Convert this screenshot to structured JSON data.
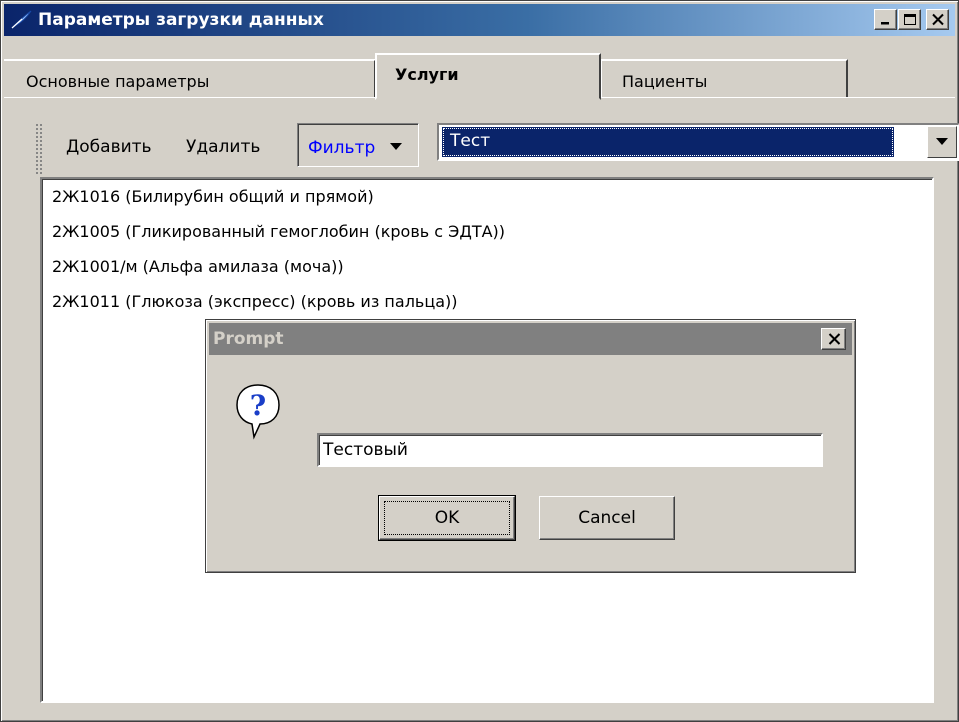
{
  "window": {
    "title": "Параметры загрузки данных",
    "icon": "app-feather-icon",
    "controls": [
      "minimize-icon",
      "maximize-icon",
      "close-icon"
    ]
  },
  "tabs": [
    {
      "label": "Основные параметры",
      "active": false
    },
    {
      "label": "Услуги",
      "active": true
    },
    {
      "label": "Пациенты",
      "active": false
    }
  ],
  "toolbar": {
    "add_label": "Добавить",
    "delete_label": "Удалить",
    "filter_label": "Фильтр",
    "combo_value": "Тест"
  },
  "services_list": [
    "2Ж1016 (Билирубин общий и прямой)",
    "2Ж1005 (Гликированный гемоглобин (кровь с ЭДТА))",
    "2Ж1001/м (Альфа амилаза (моча))",
    "2Ж1011 (Глюкоза (экспресс) (кровь из пальца))"
  ],
  "prompt_dialog": {
    "title": "Prompt",
    "icon": "question-icon",
    "input_value": "Тестовый",
    "ok_label": "OK",
    "cancel_label": "Cancel"
  },
  "colors": {
    "titlebar_active": "#0a246a",
    "titlebar_inactive": "#808080",
    "face": "#d4d0c8",
    "filter_text": "#0000ff",
    "selection": "#0a246a"
  }
}
